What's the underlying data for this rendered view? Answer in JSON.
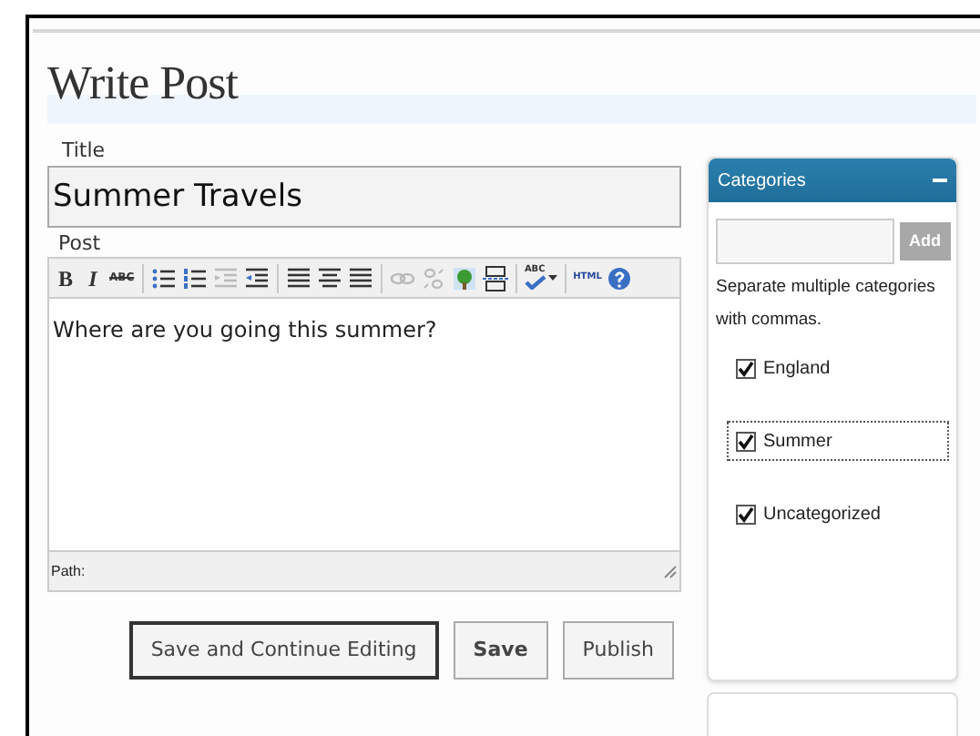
{
  "page_title": "Write Post",
  "title_field": {
    "label": "Title",
    "value": "Summer Travels"
  },
  "post": {
    "label": "Post",
    "toolbar": [
      {
        "kind": "bold",
        "label": "B",
        "disabled": false
      },
      {
        "kind": "italic",
        "label": "I",
        "disabled": false
      },
      {
        "kind": "strike",
        "label": "ABC",
        "disabled": false
      },
      {
        "kind": "sep"
      },
      {
        "kind": "bullets",
        "disabled": false
      },
      {
        "kind": "numbers",
        "disabled": false
      },
      {
        "kind": "outdent",
        "disabled": true
      },
      {
        "kind": "indent",
        "disabled": false
      },
      {
        "kind": "sep"
      },
      {
        "kind": "align-left",
        "disabled": false
      },
      {
        "kind": "align-center",
        "disabled": false
      },
      {
        "kind": "align-right",
        "disabled": false
      },
      {
        "kind": "sep"
      },
      {
        "kind": "link",
        "disabled": true
      },
      {
        "kind": "unlink",
        "disabled": true
      },
      {
        "kind": "image",
        "disabled": false
      },
      {
        "kind": "more",
        "disabled": false
      },
      {
        "kind": "sep"
      },
      {
        "kind": "spell",
        "label": "ABC",
        "disabled": false
      },
      {
        "kind": "sep"
      },
      {
        "kind": "html",
        "label": "HTML",
        "disabled": false
      },
      {
        "kind": "help",
        "disabled": false
      }
    ],
    "content": "Where are you going this summer?",
    "path_label": "Path:"
  },
  "buttons": [
    {
      "label": "Save and Continue Editing",
      "kind": "focused"
    },
    {
      "label": "Save",
      "kind": "bold"
    },
    {
      "label": "Publish",
      "kind": "plain"
    }
  ],
  "categories": {
    "title": "Categories",
    "expanded": true,
    "add_label": "Add",
    "hint": "Separate multiple categories with commas.",
    "items": [
      {
        "label": "England",
        "checked": true,
        "focused": false
      },
      {
        "label": "Summer",
        "checked": true,
        "focused": true
      },
      {
        "label": "Uncategorized",
        "checked": true,
        "focused": false
      }
    ]
  }
}
